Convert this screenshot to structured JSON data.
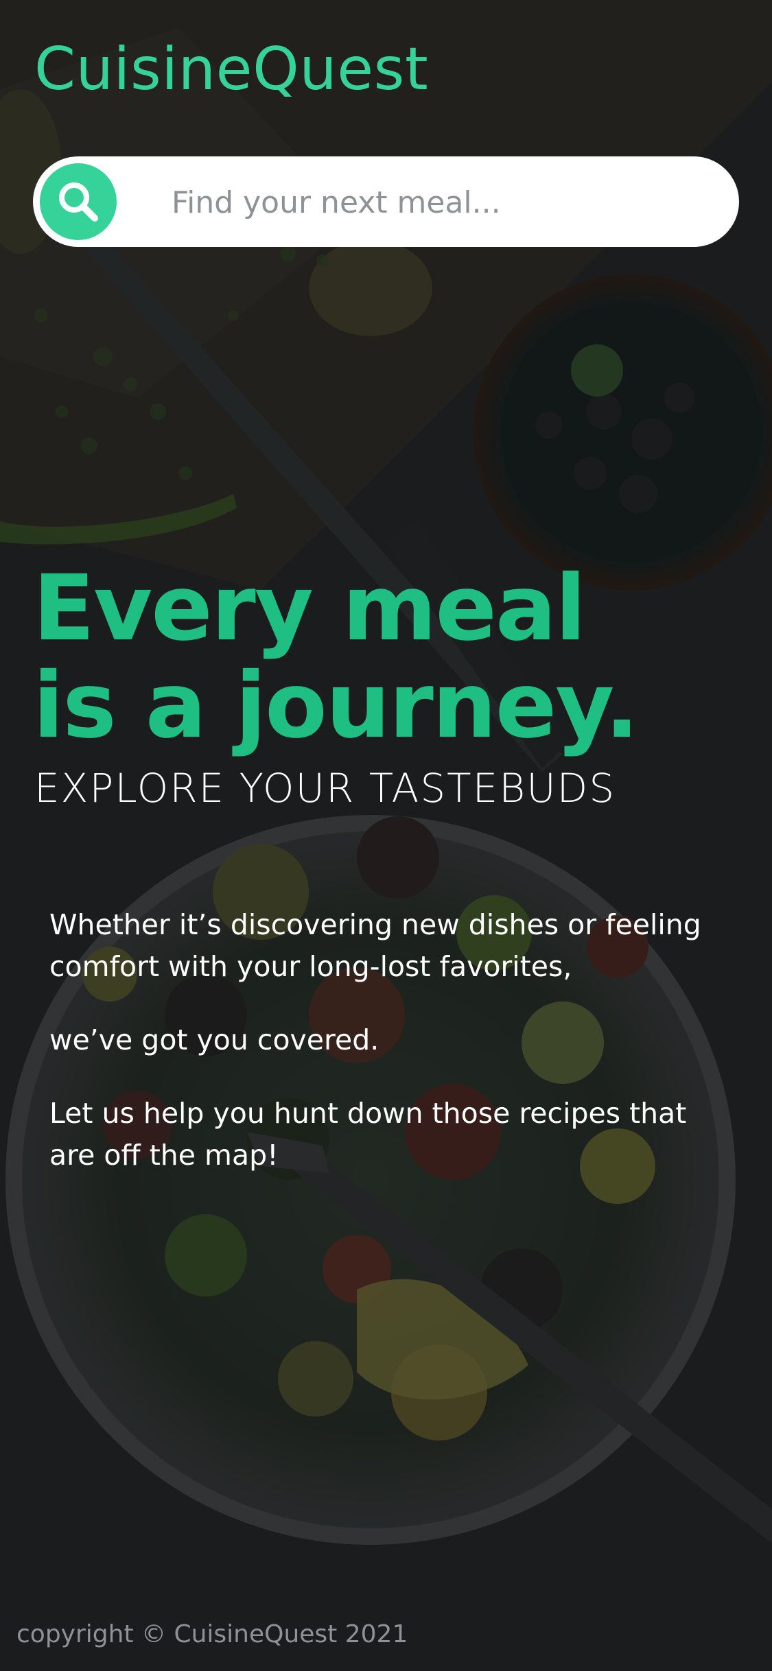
{
  "app": {
    "brand": "CuisineQuest"
  },
  "search": {
    "placeholder": "Find your next meal...",
    "icon": "search-icon"
  },
  "hero": {
    "line1": "Every meal",
    "line2": "is a journey.",
    "tagline": "EXPLORE YOUR TASTEBUDS"
  },
  "body": {
    "paragraphs": [
      "Whether it’s discovering new dishes or feeling comfort with your long-lost favorites,",
      "we’ve got you covered.",
      "Let us help you hunt down those recipes that are off the map!"
    ]
  },
  "footer": {
    "copyright": "copyright © CuisineQuest 2021"
  },
  "colors": {
    "accent": "#35d39a",
    "hero": "#1fbf83",
    "background": "#1a1c1d"
  }
}
